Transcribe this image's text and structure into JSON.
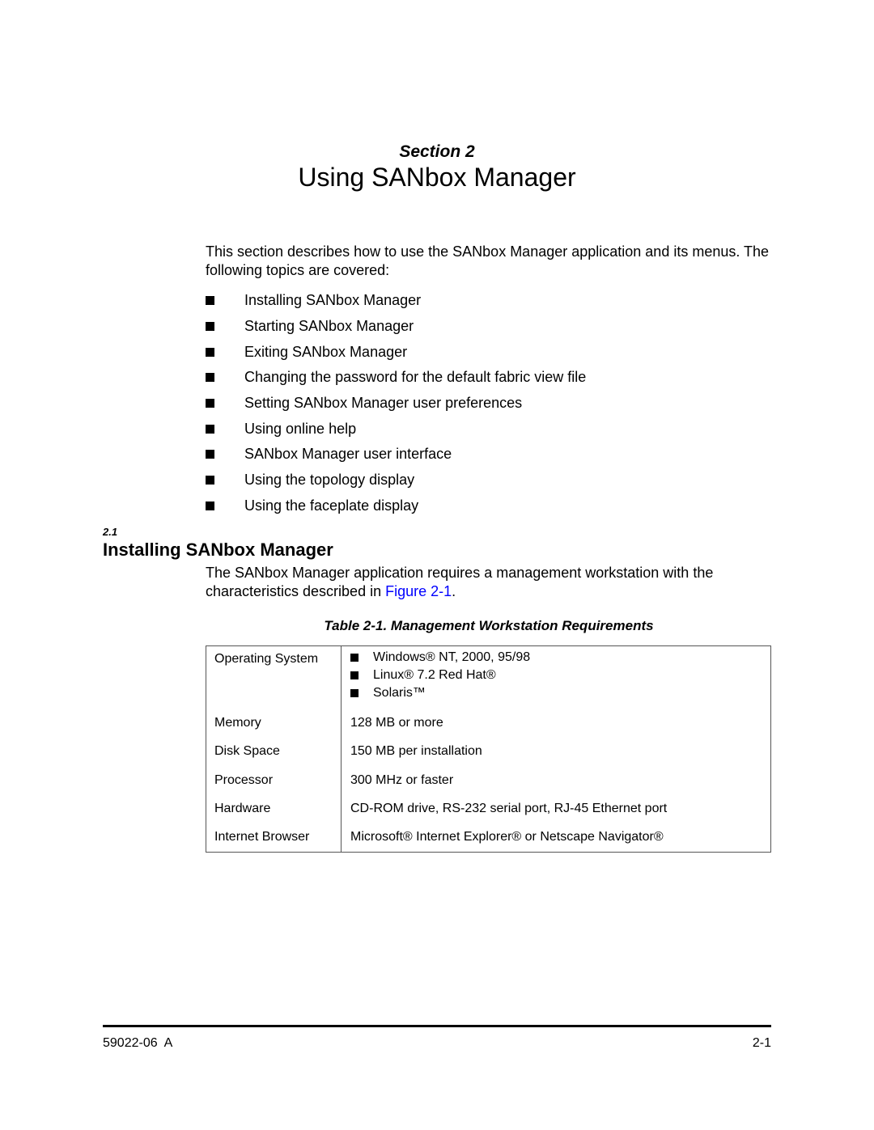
{
  "header": {
    "section_label": "Section 2",
    "title": "Using SANbox Manager"
  },
  "intro": {
    "text": "This section describes how to use the SANbox Manager application and its menus. The following topics are covered:",
    "topics": [
      "Installing SANbox Manager",
      "Starting SANbox Manager",
      "Exiting SANbox Manager",
      "Changing the password for the default fabric view file",
      "Setting SANbox Manager user preferences",
      "Using online help",
      "SANbox Manager user interface",
      "Using the topology display",
      "Using the faceplate display"
    ]
  },
  "section_2_1": {
    "number": "2.1",
    "heading": "Installing SANbox Manager",
    "body_before_link": "The SANbox Manager application requires a management workstation with the characteristics described in ",
    "link_text": "Figure 2-1",
    "body_after_link": ".",
    "link_color": "#0000ff"
  },
  "table": {
    "caption": "Table 2-1. Management Workstation Requirements",
    "rows": [
      {
        "label": "Operating System",
        "values": [
          "Windows® NT, 2000, 95/98",
          "Linux® 7.2 Red Hat®",
          "Solaris™"
        ]
      },
      {
        "label": "Memory",
        "value": "128 MB or more"
      },
      {
        "label": "Disk Space",
        "value": "150 MB per installation"
      },
      {
        "label": "Processor",
        "value": "300 MHz or faster"
      },
      {
        "label": "Hardware",
        "value": "CD-ROM drive, RS-232 serial port, RJ-45 Ethernet port"
      },
      {
        "label": "Internet Browser",
        "value": "Microsoft® Internet Explorer® or Netscape Navigator®"
      }
    ]
  },
  "footer": {
    "doc_number": "59022-06  A",
    "page_number": "2-1"
  }
}
